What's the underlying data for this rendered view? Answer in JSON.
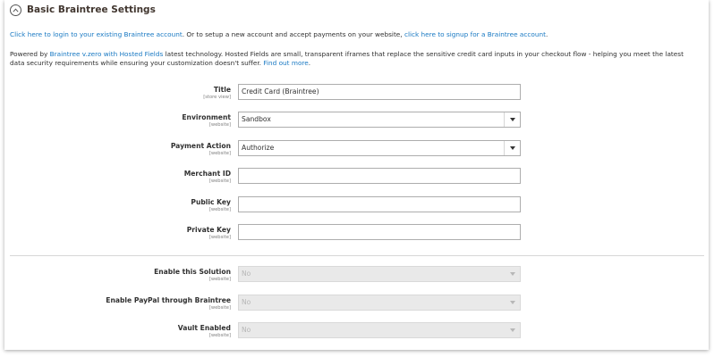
{
  "section": {
    "title": "Basic Braintree Settings"
  },
  "intro": {
    "login_link": "Click here to login to your existing Braintree account",
    "middle_text": ". Or to setup a new account and accept payments on your website, ",
    "signup_link": "click here to signup for a Braintree account",
    "end_text": "."
  },
  "description": {
    "prefix": "Powered by ",
    "tech_link": "Braintree v.zero with Hosted Fields",
    "body": " latest technology. Hosted Fields are small, transparent iframes that replace the sensitive credit card inputs in your checkout flow - helping you meet the latest data security requirements while ensuring your customization doesn't suffer. ",
    "more_link": "Find out more",
    "end": "."
  },
  "fields": {
    "title": {
      "label": "Title",
      "scope": "[store view]",
      "value": "Credit Card (Braintree)"
    },
    "environment": {
      "label": "Environment",
      "scope": "[website]",
      "value": "Sandbox"
    },
    "payment_action": {
      "label": "Payment Action",
      "scope": "[website]",
      "value": "Authorize"
    },
    "merchant_id": {
      "label": "Merchant ID",
      "scope": "[website]",
      "value": ""
    },
    "public_key": {
      "label": "Public Key",
      "scope": "[website]",
      "value": ""
    },
    "private_key": {
      "label": "Private Key",
      "scope": "[website]",
      "value": ""
    },
    "enable_solution": {
      "label": "Enable this Solution",
      "scope": "[website]",
      "value": "No"
    },
    "enable_paypal": {
      "label": "Enable PayPal through Braintree",
      "scope": "[website]",
      "value": "No"
    },
    "vault_enabled": {
      "label": "Vault Enabled",
      "scope": "[website]",
      "value": "No"
    }
  },
  "icons": {
    "collapse": "chevron-up-circle-icon",
    "dropdown": "caret-down-icon"
  },
  "colors": {
    "link": "#1979c3",
    "disabled_bg": "#e9e9e9",
    "title": "#41362f"
  }
}
